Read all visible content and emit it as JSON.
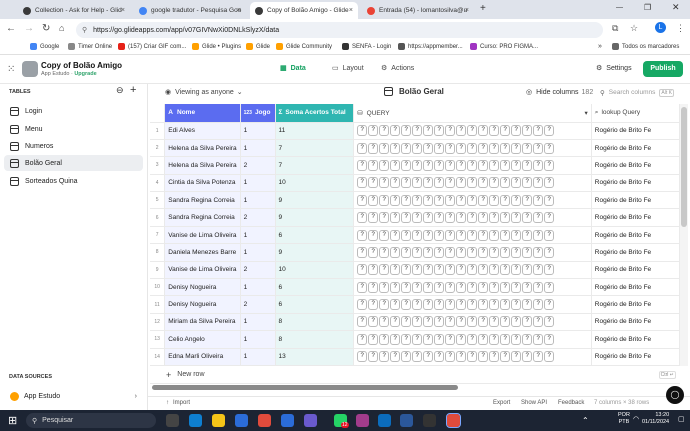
{
  "browser": {
    "tabs": [
      {
        "label": "Collection - Ask for Help - Glid",
        "color": "#3a3a3a"
      },
      {
        "label": "google tradutor - Pesquisa Goo",
        "color": "#4285f4"
      },
      {
        "label": "Copy of Bolão Amigo - Glide",
        "color": "#3a3a3a"
      },
      {
        "label": "Entrada (54) - lomantosilva@u",
        "color": "#ea4335"
      }
    ],
    "url": "https://go.glideapps.com/app/v07GIVNwXi0DNLkSlyzX/data",
    "bookmarks": [
      "Google",
      "Timer Online",
      "(157) Criar GIF com...",
      "Glide • Plugins",
      "Glide",
      "Glide Community",
      "SENFA - Login",
      "https://appmember...",
      "Curso: PRO FIGMA..."
    ],
    "all_bookmarks": "Todos os marcadores"
  },
  "app": {
    "title": "Copy of Bolão Amigo",
    "subtitle": "App Estudo",
    "upgrade": "Upgrade",
    "nav": [
      "Data",
      "Layout",
      "Actions"
    ],
    "settings": "Settings",
    "publish": "Publish"
  },
  "sidebar": {
    "tables_heading": "TABLES",
    "items": [
      "Login",
      "Menu",
      "Numeros",
      "Bolão Geral",
      "Sorteados Quina"
    ],
    "data_sources_heading": "DATA SOURCES",
    "source": "App Estudo"
  },
  "toolbar": {
    "viewing_as": "Viewing as anyone",
    "table_title": "Bolão Geral",
    "hide_columns": "Hide columns",
    "hide_count": "182",
    "search_placeholder": "Search columns",
    "search_shortcut": "Alt K"
  },
  "columns": [
    {
      "name": "Nome",
      "type": "A",
      "color": "#5b6cf0"
    },
    {
      "name": "Jogo",
      "type": "123",
      "color": "#5b6cf0"
    },
    {
      "name": "Soma Acertos Total",
      "type": "Σ",
      "color": "#2fb6b1"
    },
    {
      "name": "QUERY",
      "type": "⛁",
      "color": "#fff"
    },
    {
      "name": "lookup Query",
      "type": "⌕",
      "color": "#fff"
    }
  ],
  "rows": [
    {
      "n": "1",
      "nome": "Edi Alves",
      "jogo": "1",
      "soma": "11",
      "lookup": "Rogério de Brito Fe"
    },
    {
      "n": "2",
      "nome": "Helena da Silva Pereira",
      "jogo": "1",
      "soma": "7",
      "lookup": "Rogério de Brito Fe"
    },
    {
      "n": "3",
      "nome": "Helena da Silva Pereira",
      "jogo": "2",
      "soma": "7",
      "lookup": "Rogério de Brito Fe"
    },
    {
      "n": "4",
      "nome": "Cintia da Silva Potenza",
      "jogo": "1",
      "soma": "10",
      "lookup": "Rogério de Brito Fe"
    },
    {
      "n": "5",
      "nome": "Sandra Regina Correia",
      "jogo": "1",
      "soma": "9",
      "lookup": "Rogério de Brito Fe"
    },
    {
      "n": "6",
      "nome": "Sandra Regina Correia",
      "jogo": "2",
      "soma": "9",
      "lookup": "Rogério de Brito Fe"
    },
    {
      "n": "7",
      "nome": "Vanise de Lima Oliveira",
      "jogo": "1",
      "soma": "6",
      "lookup": "Rogério de Brito Fe"
    },
    {
      "n": "8",
      "nome": "Daniela Menezes Barre",
      "jogo": "1",
      "soma": "9",
      "lookup": "Rogério de Brito Fe"
    },
    {
      "n": "9",
      "nome": "Vanise de Lima Oliveira",
      "jogo": "2",
      "soma": "10",
      "lookup": "Rogério de Brito Fe"
    },
    {
      "n": "10",
      "nome": "Denisy Nogueira",
      "jogo": "1",
      "soma": "6",
      "lookup": "Rogério de Brito Fe"
    },
    {
      "n": "11",
      "nome": "Denisy Nogueira",
      "jogo": "2",
      "soma": "6",
      "lookup": "Rogério de Brito Fe"
    },
    {
      "n": "12",
      "nome": "Miriam da Silva Pereira",
      "jogo": "1",
      "soma": "8",
      "lookup": "Rogério de Brito Fe"
    },
    {
      "n": "13",
      "nome": "Celio Angelo",
      "jogo": "1",
      "soma": "8",
      "lookup": "Rogério de Brito Fe"
    },
    {
      "n": "14",
      "nome": "Edna Marli Oliveira",
      "jogo": "1",
      "soma": "13",
      "lookup": "Rogério de Brito Fe"
    }
  ],
  "query_cell": "?",
  "new_row": "New row",
  "new_row_shortcut": "Ctrl ↵",
  "footer": {
    "import": "Import",
    "export": "Export",
    "show_api": "Show API",
    "feedback": "Feedback",
    "summary": "7 columns × 38 rows"
  },
  "taskbar": {
    "search": "Pesquisar",
    "lang": "POR",
    "lang2": "PTB",
    "time": "13:20",
    "date": "01/11/2024",
    "badge": "12"
  }
}
